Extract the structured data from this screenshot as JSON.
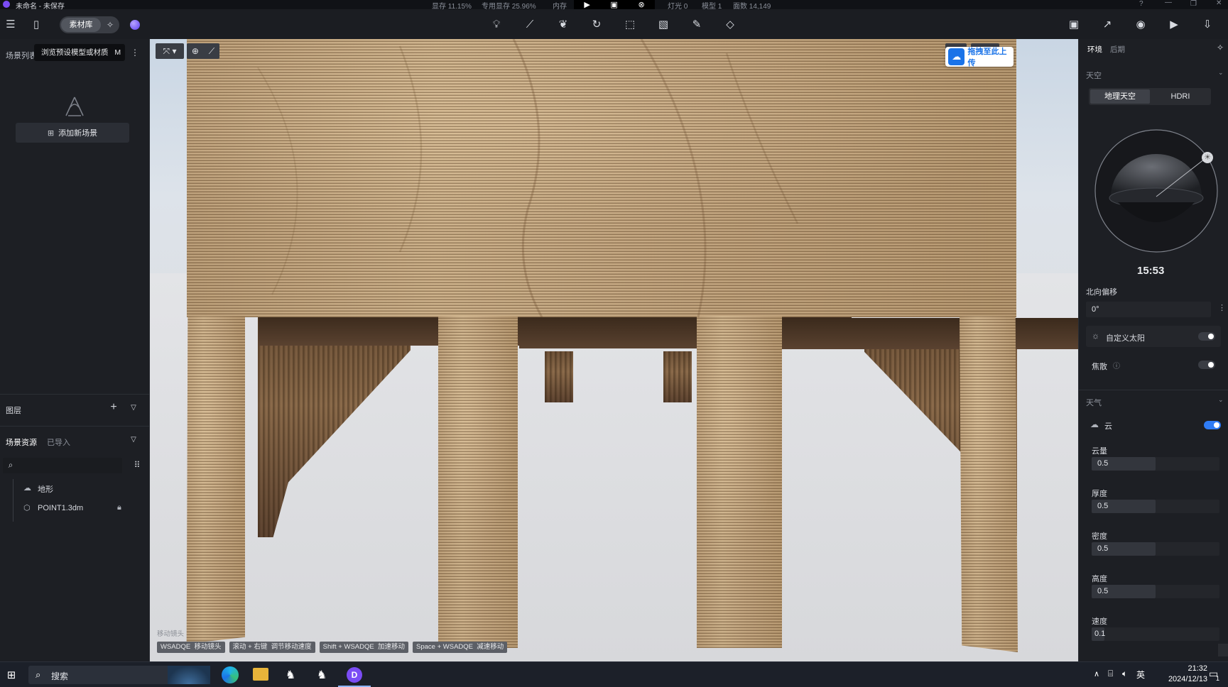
{
  "app": {
    "title": "未命名 - 未保存",
    "stats": [
      "显存 11.15%",
      "专用显存 25.96%",
      "内存",
      "灯光 0",
      "模型 1",
      "面数 14,149"
    ]
  },
  "toolbar": {
    "library_label": "素材库",
    "tooltip": "浏览预设模型或材质",
    "tooltip_key": "M"
  },
  "left_panel": {
    "scene_list_label": "场景列表",
    "add_scene_label": "添加新场景",
    "layers_label": "图层",
    "assets_tab": "场景资源",
    "imported_tab": "已导入",
    "tree": [
      {
        "label": "地形",
        "icon": "terrain-icon"
      },
      {
        "label": "POINT1.3dm",
        "icon": "model-icon"
      }
    ]
  },
  "viewport": {
    "upload_label": "拖拽至此上传",
    "hint_title": "移动镜头",
    "shortcuts": [
      {
        "key": "WSADQE",
        "action": "移动镜头"
      },
      {
        "key": "滚动 + 右键",
        "action": "调节移动速度"
      },
      {
        "key": "Shift + WSADQE",
        "action": "加速移动"
      },
      {
        "key": "Space + WSADQE",
        "action": "减速移动"
      }
    ]
  },
  "right_panel": {
    "tabs": [
      "环境",
      "后期"
    ],
    "sky_label": "天空",
    "sky_modes": [
      "地理天空",
      "HDRI"
    ],
    "time": "15:53",
    "north_offset_label": "北向偏移",
    "north_offset_value": "0°",
    "custom_sun_label": "自定义太阳",
    "caustics_label": "焦散",
    "weather_label": "天气",
    "cloud_label": "云",
    "params": [
      {
        "label": "云量",
        "value": "0.5"
      },
      {
        "label": "厚度",
        "value": "0.5"
      },
      {
        "label": "密度",
        "value": "0.5"
      },
      {
        "label": "高度",
        "value": "0.5"
      },
      {
        "label": "速度",
        "value": "0.1"
      }
    ]
  },
  "taskbar": {
    "search_label": "搜索",
    "ime": "英",
    "time": "21:32",
    "date": "2024/12/13",
    "notif_count": "1"
  },
  "colors": {
    "accent": "#2f7cf6",
    "panel": "#1d1f24",
    "upload_blue": "#1a73e8"
  }
}
